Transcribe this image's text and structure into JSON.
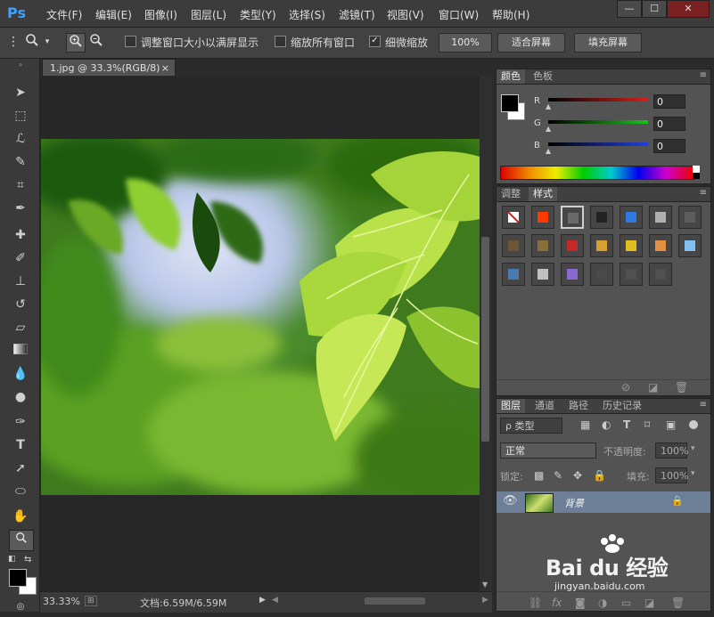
{
  "app": {
    "logo": "Ps",
    "menus": [
      "文件(F)",
      "编辑(E)",
      "图像(I)",
      "图层(L)",
      "类型(Y)",
      "选择(S)",
      "滤镜(T)",
      "视图(V)",
      "窗口(W)",
      "帮助(H)"
    ],
    "window_buttons": [
      "—",
      "☐",
      "✕"
    ]
  },
  "options": {
    "resize_windows_label": "调整窗口大小以满屏显示",
    "zoom_all_label": "缩放所有窗口",
    "scrubby_zoom_label": "细微缩放",
    "resize_windows_checked": false,
    "zoom_all_checked": false,
    "scrubby_zoom_checked": true,
    "btn_100": "100%",
    "btn_fit": "适合屏幕",
    "btn_fill": "填充屏幕"
  },
  "document": {
    "tab_title": "1.jpg @ 33.3%(RGB/8)",
    "tab_close": "×",
    "zoom": "33.33%",
    "doc_size": "文档:6.59M/6.59M"
  },
  "color_panel": {
    "tabs": [
      "颜色",
      "色板"
    ],
    "channels": [
      {
        "label": "R",
        "value": "0",
        "color": "#d42020"
      },
      {
        "label": "G",
        "value": "0",
        "color": "#20c020"
      },
      {
        "label": "B",
        "value": "0",
        "color": "#2040e0"
      }
    ],
    "foreground": "#000000",
    "background": "#ffffff"
  },
  "styles_panel": {
    "tabs": [
      "调整",
      "样式"
    ],
    "swatches": [
      {
        "name": "none",
        "color": "#ffffff"
      },
      {
        "name": "red-glow",
        "color": "#ff3a00"
      },
      {
        "name": "frame",
        "color": "#6a6a6a"
      },
      {
        "name": "chrome-dark",
        "color": "#222222"
      },
      {
        "name": "blue-glass",
        "color": "#2f78e0"
      },
      {
        "name": "gray-bevel",
        "color": "#b0b0b0"
      },
      {
        "name": "dark-gradient",
        "color": "#5d5d5d"
      },
      {
        "name": "wood",
        "color": "#6e5634"
      },
      {
        "name": "bronze",
        "color": "#8a6f3a"
      },
      {
        "name": "red-button",
        "color": "#c22a2a"
      },
      {
        "name": "rainbow",
        "color": "#d8a030"
      },
      {
        "name": "gold",
        "color": "#e0c020"
      },
      {
        "name": "sunset",
        "color": "#e09040"
      },
      {
        "name": "sky",
        "color": "#80c0f0"
      },
      {
        "name": "landscape",
        "color": "#4a7ab0"
      },
      {
        "name": "mosaic",
        "color": "#c0c0c0"
      },
      {
        "name": "purple-glass",
        "color": "#8a6ad0"
      },
      {
        "name": "dark-square",
        "color": "#4a4a4a"
      },
      {
        "name": "gray-square-1",
        "color": "#505050"
      },
      {
        "name": "gray-square-2",
        "color": "#505050"
      }
    ]
  },
  "layers_panel": {
    "tabs": [
      "图层",
      "通道",
      "路径",
      "历史记录"
    ],
    "filter_label": "ρ 类型",
    "blend_mode": "正常",
    "opacity_label": "不透明度:",
    "opacity_value": "100%",
    "lock_label": "锁定:",
    "fill_label": "填充:",
    "fill_value": "100%",
    "layer_name": "背景"
  },
  "watermark": {
    "brand": "Bai du 经验",
    "url": "jingyan.baidu.com"
  }
}
